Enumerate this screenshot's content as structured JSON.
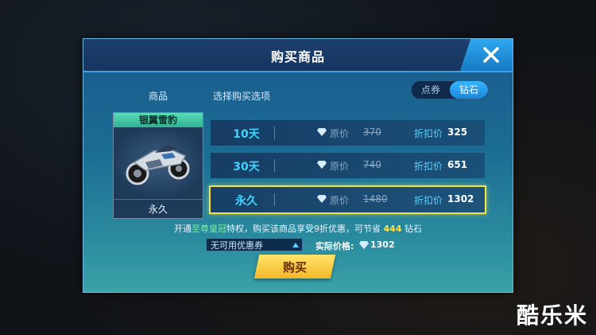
{
  "dialog": {
    "title": "购买商品",
    "close_icon": "close-icon"
  },
  "columns": {
    "item_label": "商品",
    "options_label": "选择购买选项"
  },
  "currency_toggle": {
    "options": [
      "点券",
      "钻石"
    ],
    "selected": "钻石"
  },
  "item": {
    "name": "银翼雪豹",
    "duration": "永久",
    "icon": "motorcycle-icon"
  },
  "options": [
    {
      "days": "10天",
      "orig_label": "原价",
      "orig_price": "370",
      "disc_label": "折扣价",
      "disc_price": "325",
      "selected": false
    },
    {
      "days": "30天",
      "orig_label": "原价",
      "orig_price": "740",
      "disc_label": "折扣价",
      "disc_price": "651",
      "selected": false
    },
    {
      "days": "永久",
      "orig_label": "原价",
      "orig_price": "1480",
      "disc_label": "折扣价",
      "disc_price": "1302",
      "selected": true
    }
  ],
  "promo": {
    "prefix": "开通",
    "vip": "至尊皇冠",
    "middle": "特权，购买该商品享受9折优惠，可节省",
    "save_amount": "444",
    "suffix": "钻石"
  },
  "coupon": {
    "selected": "无可用优惠券"
  },
  "actual_price": {
    "label": "实际价格:",
    "value": "1302"
  },
  "buy_button": {
    "label": "购买"
  },
  "watermark": "酷乐米",
  "colors": {
    "accent_blue": "#3fd4ff",
    "selected_border": "#f2e24a",
    "buy_yellow": "#f4b728",
    "item_header_green": "#2fb293"
  }
}
